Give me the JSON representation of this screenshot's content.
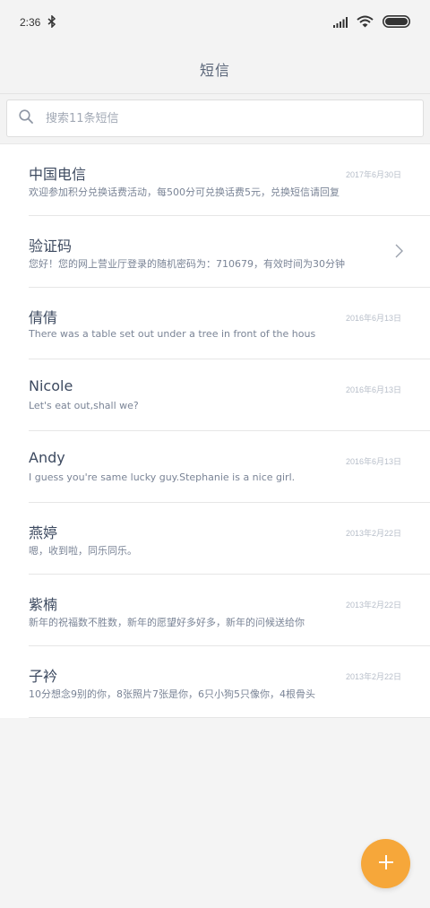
{
  "status": {
    "time": "2:36",
    "bluetooth_icon": "bluetooth-icon",
    "signal_icon": "signal-icon",
    "wifi_icon": "wifi-icon",
    "battery_icon": "battery-icon"
  },
  "header": {
    "title": "短信"
  },
  "search": {
    "placeholder": "搜索11条短信",
    "icon": "search-icon"
  },
  "conversations": [
    {
      "name": "中国电信",
      "preview": "欢迎参加积分兑换话费活动，每500分可兑换话费5元，兑换短信请回复",
      "date": "2017年6月30日"
    },
    {
      "name": "验证码",
      "preview": "您好！您的网上营业厅登录的随机密码为：710679，有效时间为30分钟",
      "date": "",
      "chevron": true
    },
    {
      "name": "倩倩",
      "preview": "There was a table set out under a tree in front of the hous",
      "date": "2016年6月13日"
    },
    {
      "name": "Nicole",
      "preview": "Let's eat out,shall we?",
      "date": "2016年6月13日"
    },
    {
      "name": "Andy",
      "preview": "I guess you're same lucky guy.Stephanie is a nice girl.",
      "date": "2016年6月13日"
    },
    {
      "name": "燕婷",
      "preview": "嗯，收到啦，同乐同乐。",
      "date": "2013年2月22日"
    },
    {
      "name": "紫楠",
      "preview": "新年的祝福数不胜数，新年的愿望好多好多，新年的问候送给你",
      "date": "2013年2月22日"
    },
    {
      "name": "子衿",
      "preview": "10分想念9别的你，8张照片7张是你，6只小狗5只像你，4根骨头",
      "date": "2013年2月22日"
    }
  ],
  "fab": {
    "icon": "plus-icon",
    "color": "#f6a73a"
  }
}
